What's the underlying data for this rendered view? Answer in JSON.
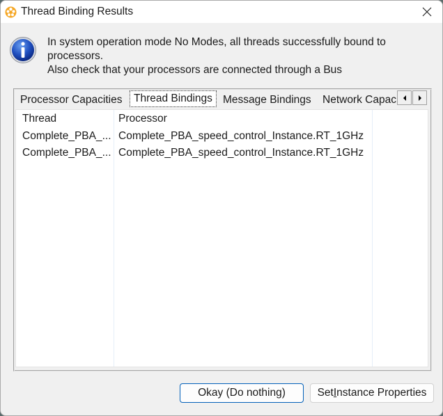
{
  "window": {
    "title": "Thread Binding Results",
    "app_icon": "app-logo-icon",
    "close_icon": "close-icon"
  },
  "message": {
    "icon": "info-icon",
    "lines": [
      "In system operation mode No Modes, all threads successfully bound to",
      "processors.",
      "Also check that your processors are connected through a Bus"
    ]
  },
  "tabs": [
    {
      "label": "Processor Capacities",
      "active": false
    },
    {
      "label": "Thread Bindings",
      "active": true
    },
    {
      "label": "Message Bindings",
      "active": false
    },
    {
      "label": "Network Capacities",
      "active": false
    }
  ],
  "tab_scroll": {
    "left_icon": "scroll-left-icon",
    "right_icon": "scroll-right-icon"
  },
  "table": {
    "columns": [
      "Thread",
      "Processor"
    ],
    "rows": [
      [
        "Complete_PBA_...",
        "Complete_PBA_speed_control_Instance.RT_1GHz"
      ],
      [
        "Complete_PBA_...",
        "Complete_PBA_speed_control_Instance.RT_1GHz"
      ]
    ]
  },
  "buttons": {
    "okay": "Okay (Do nothing)",
    "set_props_pre": "Set ",
    "set_props_mn": "I",
    "set_props_post": "nstance Properties"
  }
}
